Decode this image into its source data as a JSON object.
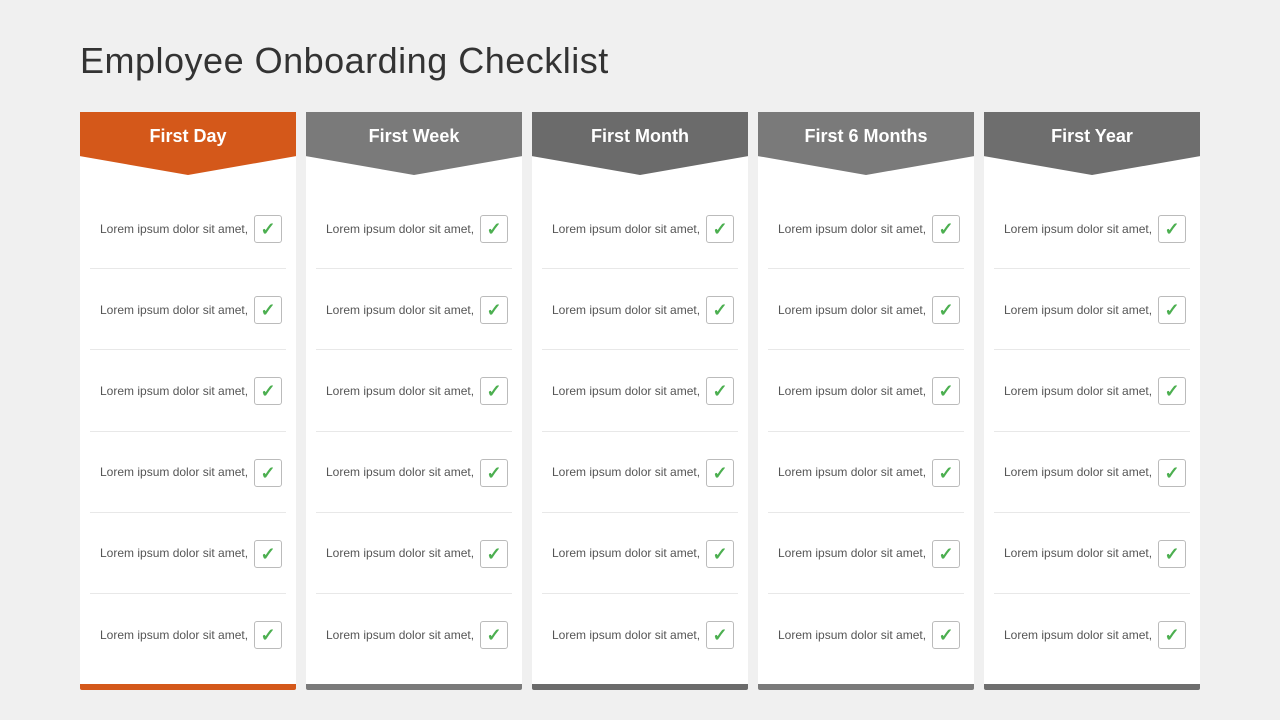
{
  "title": "Employee  Onboarding Checklist",
  "columns": [
    {
      "id": "first-day",
      "label": "First Day",
      "colorClass": "orange",
      "items": [
        {
          "text": "Lorem ipsum\ndolor sit amet,"
        },
        {
          "text": "Lorem ipsum\ndolor sit amet,"
        },
        {
          "text": "Lorem ipsum\ndolor sit amet,"
        },
        {
          "text": "Lorem ipsum\ndolor sit amet,"
        },
        {
          "text": "Lorem ipsum\ndolor sit amet,"
        },
        {
          "text": "Lorem ipsum\ndolor sit amet,"
        }
      ]
    },
    {
      "id": "first-week",
      "label": "First Week",
      "colorClass": "gray1",
      "items": [
        {
          "text": "Lorem ipsum\ndolor sit amet,"
        },
        {
          "text": "Lorem ipsum\ndolor sit amet,"
        },
        {
          "text": "Lorem ipsum\ndolor sit amet,"
        },
        {
          "text": "Lorem ipsum\ndolor sit amet,"
        },
        {
          "text": "Lorem ipsum\ndolor sit amet,"
        },
        {
          "text": "Lorem ipsum\ndolor sit amet,"
        }
      ]
    },
    {
      "id": "first-month",
      "label": "First Month",
      "colorClass": "gray2",
      "items": [
        {
          "text": "Lorem ipsum\ndolor sit amet,"
        },
        {
          "text": "Lorem ipsum\ndolor sit amet,"
        },
        {
          "text": "Lorem ipsum\ndolor sit amet,"
        },
        {
          "text": "Lorem ipsum\ndolor sit amet,"
        },
        {
          "text": "Lorem ipsum\ndolor sit amet,"
        },
        {
          "text": "Lorem ipsum\ndolor sit amet,"
        }
      ]
    },
    {
      "id": "first-6-months",
      "label": "First 6 Months",
      "colorClass": "gray3",
      "items": [
        {
          "text": "Lorem ipsum\ndolor sit amet,"
        },
        {
          "text": "Lorem ipsum\ndolor sit amet,"
        },
        {
          "text": "Lorem ipsum\ndolor sit amet,"
        },
        {
          "text": "Lorem ipsum\ndolor sit amet,"
        },
        {
          "text": "Lorem ipsum\ndolor sit amet,"
        },
        {
          "text": "Lorem ipsum\ndolor sit amet,"
        }
      ]
    },
    {
      "id": "first-year",
      "label": "First Year",
      "colorClass": "gray4",
      "items": [
        {
          "text": "Lorem ipsum\ndolor sit amet,"
        },
        {
          "text": "Lorem ipsum\ndolor sit amet,"
        },
        {
          "text": "Lorem ipsum\ndolor sit amet,"
        },
        {
          "text": "Lorem ipsum\ndolor sit amet,"
        },
        {
          "text": "Lorem ipsum\ndolor sit amet,"
        },
        {
          "text": "Lorem ipsum\ndolor sit amet,"
        }
      ]
    }
  ],
  "checkmark": "✓"
}
